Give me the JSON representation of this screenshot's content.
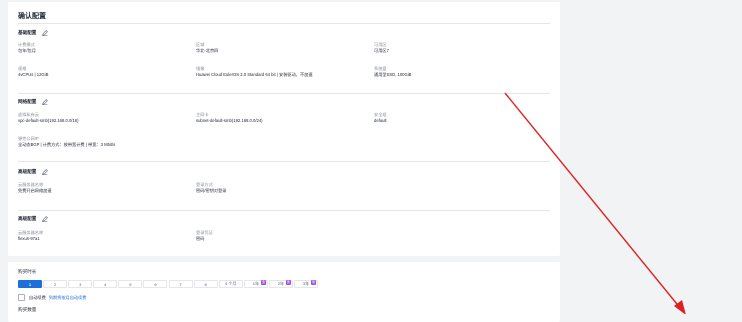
{
  "confirm": {
    "title": "确认配置",
    "basic": {
      "heading": "基础配置",
      "billing_label": "计费模式",
      "billing_value": "包年/包月",
      "region_label": "区域",
      "region_value": "华北-北京四",
      "az_label": "可用区",
      "az_value": "可用区7",
      "spec_label": "规格",
      "spec_value": "4vCPUs | 12GiB",
      "image_label": "镜像",
      "image_value": "Huawei Cloud EulerOS 2.0 Standard 64 bit | 安装驱动，不加速",
      "disk_label": "系统盘",
      "disk_value": "通用型SSD, 100GiB"
    },
    "network": {
      "heading": "网络配置",
      "vpc_label": "虚拟私有云",
      "vpc_value": "vpc-default-smb(192.168.0.0/16)",
      "subnet_label": "主网卡",
      "subnet_value": "subnet-default-smb(192.168.0.0/24)",
      "sg_label": "安全组",
      "sg_value": "default",
      "eip_label": "弹性公网IP",
      "eip_value": "全动态BGP | 计费方式：按带宽计费 | 带宽：3 Mbit/s"
    },
    "advanced": {
      "heading": "高级配置",
      "host_label": "云服务器名称",
      "host_value": "免费开启网络加速",
      "pwd_label": "登录方式",
      "pwd_value": "密码/密钥对登录"
    },
    "other": {
      "heading": "高级配置",
      "name_label": "云服务器名称",
      "name_value": "flexus-97a1",
      "tag_label": "登录凭证",
      "tag_value": "密码"
    }
  },
  "duration": {
    "label": "购买时长",
    "options": [
      "1",
      "2",
      "3",
      "4",
      "5",
      "6",
      "7",
      "8",
      "9 个月",
      "1年",
      "2年",
      "3年"
    ],
    "selected_index": 0,
    "promo_badge": "惠",
    "auto_renew_label": "自动续费",
    "auto_renew_link": "到期将按月自动续费",
    "quantity_label": "购买数量"
  },
  "colors": {
    "accent": "#1e6fd9",
    "promo": "#9b53e0",
    "annotation": "#e02020"
  }
}
